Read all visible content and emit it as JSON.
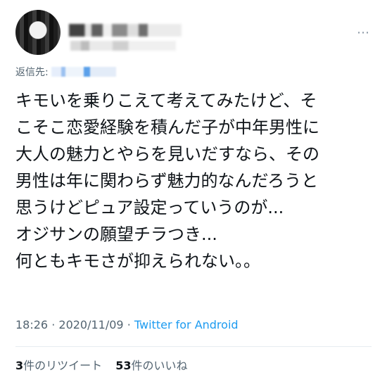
{
  "header": {
    "more_icon": "⋯"
  },
  "reply": {
    "prefix": "返信先:"
  },
  "tweet": {
    "text": "キモいを乗りこえて考えてみたけど、そ\nこそこ恋愛経験を積んだ子が中年男性に\n大人の魅力とやらを見いだすなら、その\n男性は年に関わらず魅力的なんだろうと\n思うけどピュア設定っていうのが...\nオジサンの願望チラつき...\n何ともキモさが抑えられない。。"
  },
  "meta": {
    "time": "18:26",
    "date": "2020/11/09",
    "separator": "·",
    "source": "Twitter for Android"
  },
  "stats": {
    "retweets_count": "3",
    "retweets_label": "件のリツイート",
    "likes_count": "53",
    "likes_label": "件のいいね"
  }
}
